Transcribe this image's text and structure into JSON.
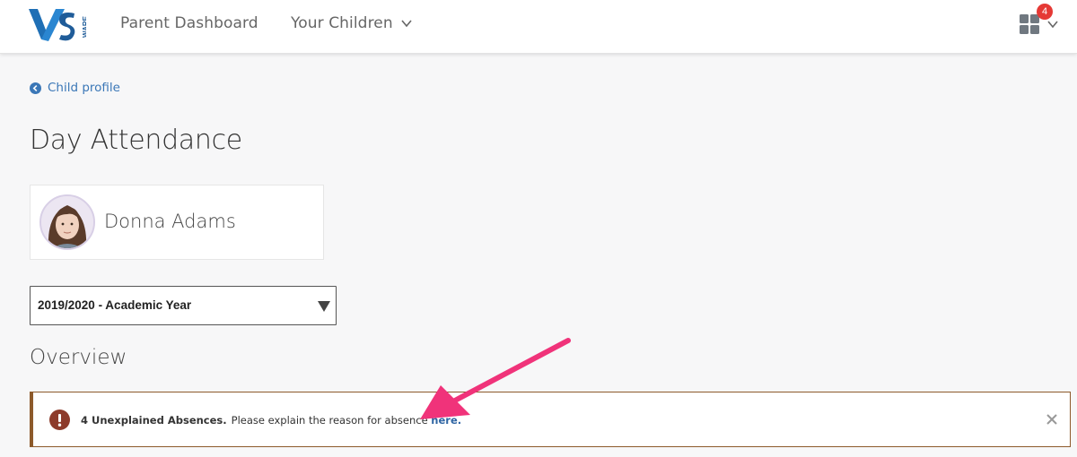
{
  "header": {
    "logo_text": "VS WARE",
    "nav": {
      "dashboard_label": "Parent Dashboard",
      "children_label": "Your Children"
    },
    "notification_count": "4"
  },
  "breadcrumb": {
    "back_label": "Child profile"
  },
  "page": {
    "title": "Day Attendance"
  },
  "child": {
    "name": "Donna Adams"
  },
  "year_select": {
    "selected": "2019/2020 - Academic Year"
  },
  "overview": {
    "heading": "Overview"
  },
  "alert": {
    "strong_text": "4 Unexplained Absences.",
    "message": "Please explain the reason for absence ",
    "link_text": "here."
  },
  "colors": {
    "brand_blue": "#1f5c99",
    "link_blue": "#3b77b7",
    "alert_border": "#8d5a2b",
    "badge_red": "#e53935",
    "annotation_pink": "#f0337a"
  }
}
